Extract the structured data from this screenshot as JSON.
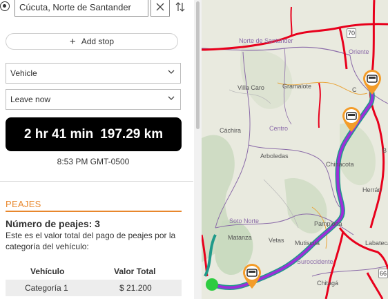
{
  "origin": {
    "value": "Cúcuta, Norte de Santander",
    "clear_icon": "close-icon",
    "swap_icon": "swap-vertical-icon"
  },
  "add_stop": {
    "label": "Add stop",
    "icon": "plus-icon"
  },
  "vehicle_select": {
    "value": "Vehicle"
  },
  "departure_select": {
    "value": "Leave now"
  },
  "summary": {
    "duration": "2 hr 41 min",
    "distance": "197.29 km"
  },
  "arrival_time": "8:53 PM GMT-0500",
  "tolls": {
    "title": "PEAJES",
    "count_text": "Número de peajes: 3",
    "description": "Este es el valor total del pago de peajes por la categoría del vehículo:",
    "table": {
      "headers": [
        "Vehículo",
        "Valor Total"
      ],
      "rows": [
        {
          "vehicle": "Categoría 1",
          "total": "$ 21.200"
        }
      ]
    },
    "accent_color": "#e8872c"
  },
  "map": {
    "labels": {
      "norte_de_santander": "Norte de Santander",
      "oriente": "Oriente",
      "villa_caro": "Villa Caro",
      "gramalote": "Gramalote",
      "cachira": "Cáchira",
      "centro": "Centro",
      "arboledas": "Arboledas",
      "chinacota": "Chinácota",
      "herran": "Herrán",
      "soto_norte": "Soto Norte",
      "matanza": "Matanza",
      "vetas": "Vetas",
      "pamplona": "Pamplona",
      "mutiscua": "Mutiscua",
      "suroccidente": "Suroccidente",
      "labateca": "Labateca",
      "chitaga": "Chitagá",
      "cucuta_abbr": "C",
      "b_abbr": "B"
    },
    "road_shields": [
      "70",
      "66"
    ],
    "route_color": "#9b30d9",
    "highway_color": "#e8001c",
    "toll_icon": "toll-booth-icon",
    "start_marker_color": "#2ecc40"
  }
}
